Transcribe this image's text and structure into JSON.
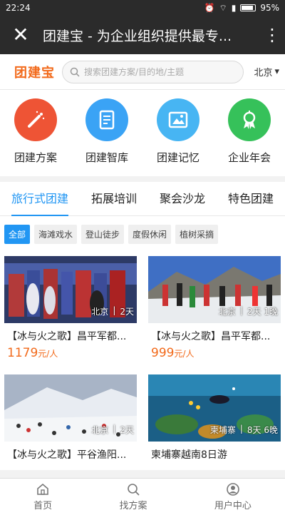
{
  "status": {
    "time": "22:24",
    "battery": "95%"
  },
  "appbar": {
    "title": "团建宝 - 为企业组织提供最专..."
  },
  "header": {
    "logo": "团建宝",
    "search_placeholder": "搜索团建方案/目的地/主题",
    "city": "北京"
  },
  "categories": [
    {
      "label": "团建方案",
      "color": "#ee5435",
      "icon": "magic-wand-icon"
    },
    {
      "label": "团建智库",
      "color": "#3aa3f5",
      "icon": "document-icon"
    },
    {
      "label": "团建记忆",
      "color": "#47b5f3",
      "icon": "image-icon"
    },
    {
      "label": "企业年会",
      "color": "#36c15a",
      "icon": "ribbon-icon"
    }
  ],
  "tabs": [
    {
      "label": "旅行式团建",
      "active": true
    },
    {
      "label": "拓展培训",
      "active": false
    },
    {
      "label": "聚会沙龙",
      "active": false
    },
    {
      "label": "特色团建",
      "active": false
    }
  ],
  "filters": [
    "全部",
    "海滩戏水",
    "登山徒步",
    "度假休闲",
    "植树采摘"
  ],
  "products": [
    {
      "name": "【冰与火之歌】昌平军都...",
      "location": "北京",
      "duration": "2天",
      "price": "1179",
      "unit": "元/人"
    },
    {
      "name": "【冰与火之歌】昌平军都...",
      "location": "北京",
      "duration": "2天 1晚",
      "price": "999",
      "unit": "元/人"
    },
    {
      "name": "【冰与火之歌】平谷渔阳...",
      "location": "北京",
      "duration": "2天",
      "price": "",
      "unit": ""
    },
    {
      "name": "柬埔寨越南8日游",
      "location": "柬埔寨",
      "duration": "8天 6晚",
      "price": "",
      "unit": ""
    }
  ],
  "bottom_nav": [
    "首页",
    "找方案",
    "用户中心"
  ]
}
